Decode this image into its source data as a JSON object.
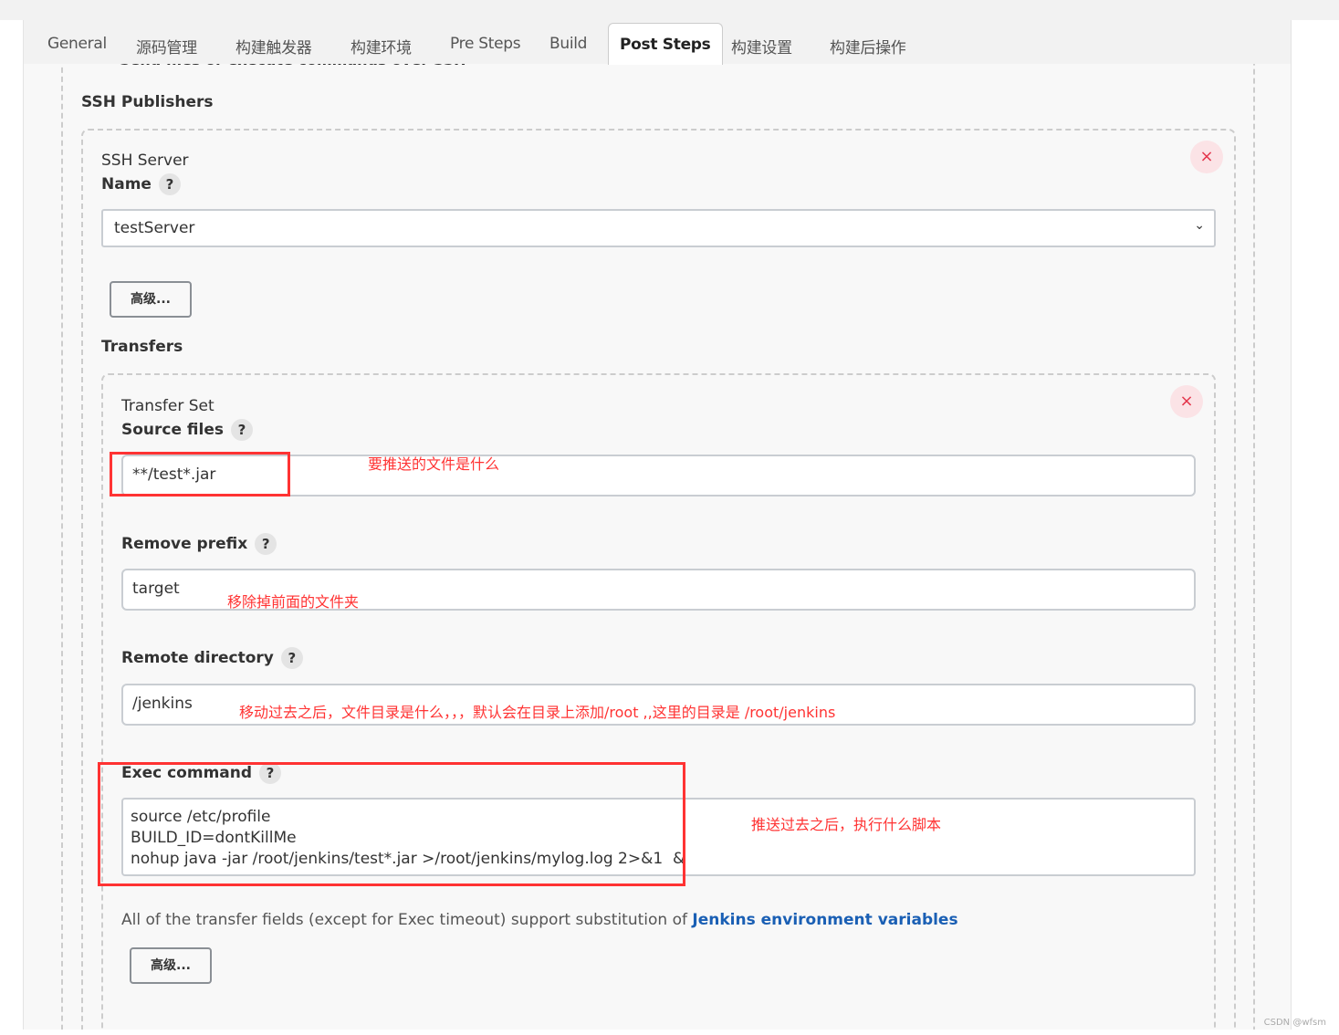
{
  "tabs": [
    {
      "label": "General"
    },
    {
      "label": "源码管理"
    },
    {
      "label": "构建触发器"
    },
    {
      "label": "构建环境"
    },
    {
      "label": "Pre Steps"
    },
    {
      "label": "Build"
    },
    {
      "label": "Post Steps",
      "active": true
    },
    {
      "label": "构建设置"
    },
    {
      "label": "构建后操作"
    }
  ],
  "section_title": "Send files or execute commands over SSH",
  "ssh_publishers": "SSH Publishers",
  "server": {
    "heading": "SSH Server",
    "name_label": "Name",
    "help": "?",
    "name_value": "testServer",
    "advanced": "高级..."
  },
  "transfers_label": "Transfers",
  "transfer_set": {
    "heading": "Transfer Set",
    "source_label": "Source files",
    "source_value": "**/test*.jar",
    "remove_prefix_label": "Remove prefix",
    "remove_prefix_value": "target",
    "remote_dir_label": "Remote directory",
    "remote_dir_value": "/jenkins",
    "exec_label": "Exec command",
    "exec_lines": [
      "source /etc/profile",
      "BUILD_ID=dontKillMe",
      "nohup java -jar /root/jenkins/test*.jar >/root/jenkins/mylog.log 2>&1  &"
    ],
    "info_text": "All of the transfer fields (except for Exec timeout) support substitution of ",
    "info_link": "Jenkins environment variables",
    "advanced": "高级..."
  },
  "annotations": {
    "source": "要推送的文件是什么",
    "prefix": "移除掉前面的文件夹",
    "remote": "移动过去之后，文件目录是什么，，，默认会在目录上添加/root  ,,这里的目录是 /root/jenkins",
    "exec": "推送过去之后，执行什么脚本"
  },
  "close_icon": "×",
  "watermark": "CSDN @wfsm",
  "colors": {
    "annotation": "#ff3333",
    "link": "#1a5fb4",
    "close": "#e4354b"
  }
}
